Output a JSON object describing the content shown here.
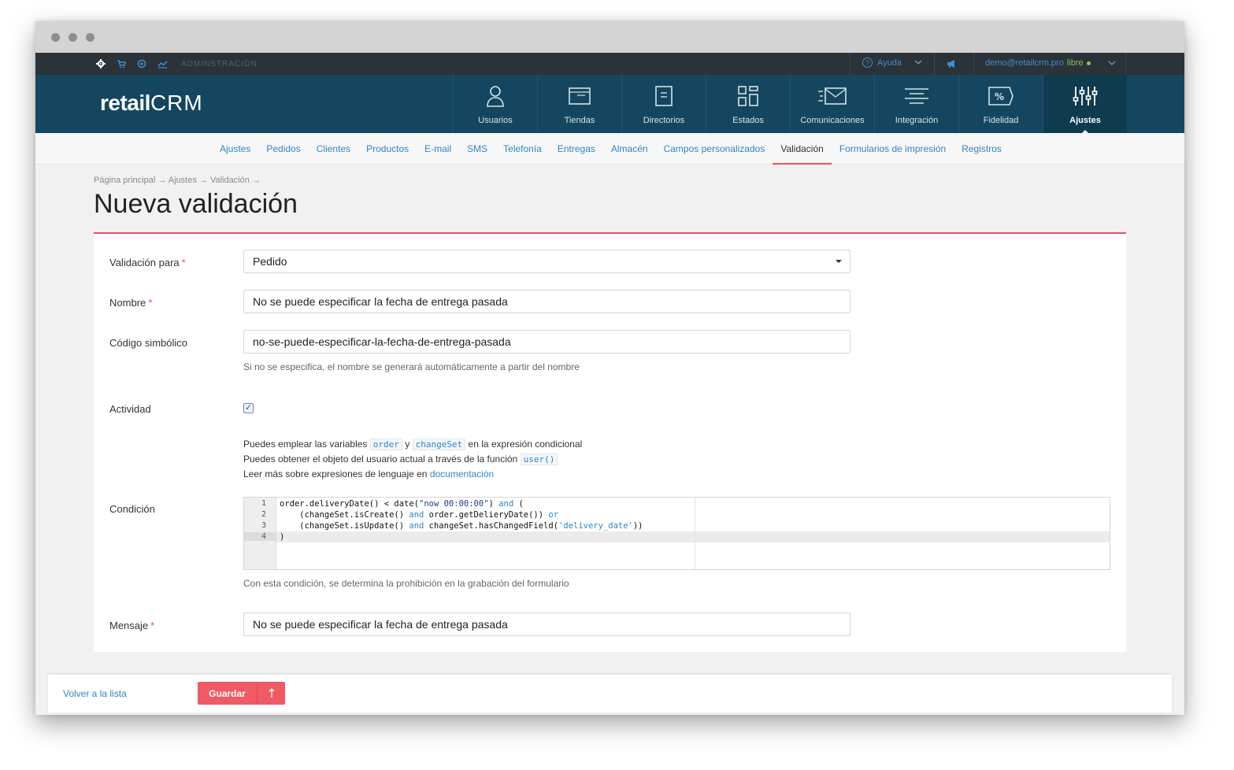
{
  "topbar": {
    "admin_label": "ADMINSTRACIÓN",
    "help_label": "Ayuda",
    "user_email": "demo@retailcrm.pro",
    "user_plan": "libre"
  },
  "header": {
    "logo_part1": "retail",
    "logo_part2": "CRM",
    "nav": [
      {
        "label": "Usuarios",
        "icon": "user-icon"
      },
      {
        "label": "Tiendas",
        "icon": "store-icon"
      },
      {
        "label": "Directorios",
        "icon": "directory-icon"
      },
      {
        "label": "Estados",
        "icon": "statuses-icon"
      },
      {
        "label": "Comunicaciones",
        "icon": "communications-icon"
      },
      {
        "label": "Integración",
        "icon": "integration-icon"
      },
      {
        "label": "Fidelidad",
        "icon": "loyalty-icon"
      },
      {
        "label": "Ajustes",
        "icon": "settings-sliders-icon"
      }
    ]
  },
  "subnav": [
    "Ajustes",
    "Pedidos",
    "Clientes",
    "Productos",
    "E-mail",
    "SMS",
    "Telefonía",
    "Entregas",
    "Almacén",
    "Campos personalizados",
    "Validación",
    "Formularios de impresión",
    "Registros"
  ],
  "breadcrumb": "Página principal → Ajustes → Validación →",
  "page_title": "Nueva validación",
  "form": {
    "validation_for_label": "Validación para",
    "validation_for_value": "Pedido",
    "name_label": "Nombre",
    "name_value": "No se puede especificar la fecha de entrega pasada",
    "code_label": "Código simbólico",
    "code_value": "no-se-puede-especificar-la-fecha-de-entrega-pasada",
    "code_hint": "Si no se especifica, el nombre se generará automáticamente a partir del nombre",
    "activity_label": "Actividad",
    "activity_checked": true,
    "help_line1_a": "Puedes emplear las variables",
    "help_var1": "order",
    "help_line1_b": "y",
    "help_var2": "changeSet",
    "help_line1_c": "en la expresión condicional",
    "help_line2_a": "Puedes obtener el objeto del usuario actual a través de la función",
    "help_func": "user()",
    "help_line3_a": "Leer más sobre expresiones de lenguaje en",
    "help_link": "documentación",
    "condition_label": "Condición",
    "condition_hint": "Con esta condición, se determina la prohibición en la grabación del formulario",
    "message_label": "Mensaje",
    "message_value": "No se puede especificar la fecha de entrega pasada",
    "required_mark": "*"
  },
  "code_lines": [
    "1",
    "2",
    "3",
    "4"
  ],
  "footer": {
    "back_label": "Volver a la lista",
    "save_label": "Guardar"
  },
  "colors": {
    "header": "#14475f",
    "accent": "#e8505b",
    "link": "#2f86c7"
  }
}
